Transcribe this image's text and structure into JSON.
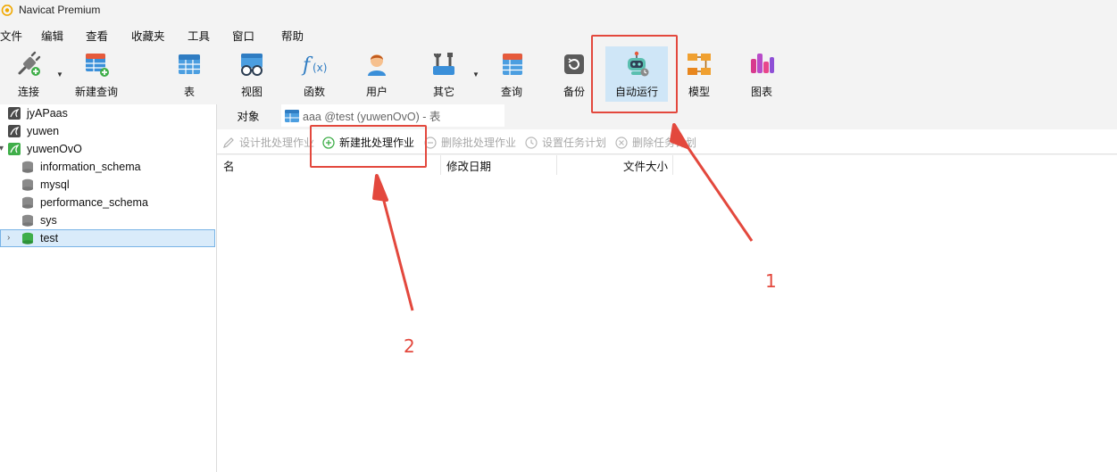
{
  "window": {
    "title": "Navicat Premium"
  },
  "menu": [
    "文件",
    "编辑",
    "查看",
    "收藏夹",
    "工具",
    "窗口",
    "帮助"
  ],
  "toolbar": {
    "connect": "连接",
    "new_query": "新建查询",
    "table": "表",
    "view": "视图",
    "function": "函数",
    "user": "用户",
    "other": "其它",
    "query": "查询",
    "backup": "备份",
    "automation": "自动运行",
    "model": "模型",
    "chart": "图表"
  },
  "sidebar": {
    "connections": [
      {
        "label": "jyAPaas"
      },
      {
        "label": "yuwen"
      },
      {
        "label": "yuwenOvO"
      }
    ],
    "databases": [
      {
        "label": "information_schema"
      },
      {
        "label": "mysql"
      },
      {
        "label": "performance_schema"
      },
      {
        "label": "sys"
      },
      {
        "label": "test"
      }
    ]
  },
  "tabs": {
    "objects": "对象",
    "table_tab": "aaa @test (yuwenOvO) - 表"
  },
  "subtoolbar": {
    "design_batch_job": "设计批处理作业",
    "new_batch_job": "新建批处理作业",
    "delete_batch_job": "删除批处理作业",
    "set_schedule": "设置任务计划",
    "delete_schedule": "删除任务计划"
  },
  "grid": {
    "columns": [
      "名",
      "修改日期",
      "文件大小"
    ]
  },
  "annotations": {
    "marker1": "1",
    "marker2": "2"
  },
  "colors": {
    "annotation": "#e3483d",
    "active_tool": "#cfe6f7",
    "selection": "#d9ebfa"
  }
}
